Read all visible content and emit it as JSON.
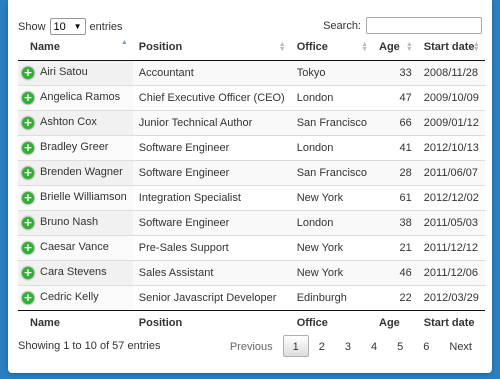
{
  "length": {
    "show_label": "Show",
    "value": "10",
    "entries_label": "entries"
  },
  "search": {
    "label": "Search:",
    "value": ""
  },
  "columns": [
    "Name",
    "Position",
    "Office",
    "Age",
    "Start date"
  ],
  "rows": [
    [
      "Airi Satou",
      "Accountant",
      "Tokyo",
      "33",
      "2008/11/28"
    ],
    [
      "Angelica Ramos",
      "Chief Executive Officer (CEO)",
      "London",
      "47",
      "2009/10/09"
    ],
    [
      "Ashton Cox",
      "Junior Technical Author",
      "San Francisco",
      "66",
      "2009/01/12"
    ],
    [
      "Bradley Greer",
      "Software Engineer",
      "London",
      "41",
      "2012/10/13"
    ],
    [
      "Brenden Wagner",
      "Software Engineer",
      "San Francisco",
      "28",
      "2011/06/07"
    ],
    [
      "Brielle Williamson",
      "Integration Specialist",
      "New York",
      "61",
      "2012/12/02"
    ],
    [
      "Bruno Nash",
      "Software Engineer",
      "London",
      "38",
      "2011/05/03"
    ],
    [
      "Caesar Vance",
      "Pre-Sales Support",
      "New York",
      "21",
      "2011/12/12"
    ],
    [
      "Cara Stevens",
      "Sales Assistant",
      "New York",
      "46",
      "2011/12/06"
    ],
    [
      "Cedric Kelly",
      "Senior Javascript Developer",
      "Edinburgh",
      "22",
      "2012/03/29"
    ]
  ],
  "expand_icon": "+",
  "info": "Showing 1 to 10 of 57 entries",
  "pagination": {
    "previous": "Previous",
    "pages": [
      "1",
      "2",
      "3",
      "4",
      "5",
      "6"
    ],
    "current": "1",
    "next": "Next"
  },
  "colors": {
    "background": "#2a7fc1",
    "expand_icon": "#31b131"
  }
}
